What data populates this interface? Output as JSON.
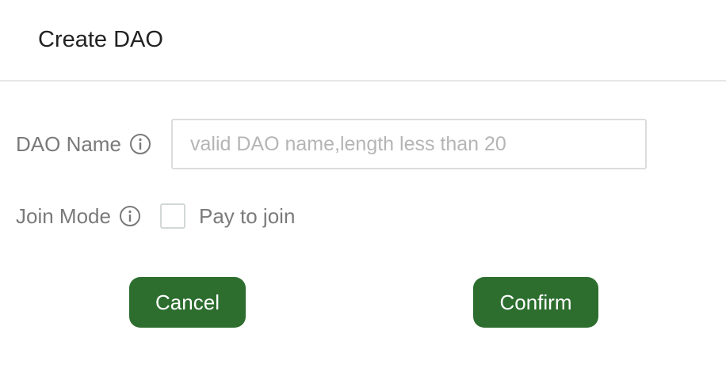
{
  "dialog": {
    "title": "Create DAO"
  },
  "form": {
    "dao_name": {
      "label": "DAO Name",
      "placeholder": "valid DAO name,length less than 20",
      "value": ""
    },
    "join_mode": {
      "label": "Join Mode",
      "option_label": "Pay to join",
      "checked": false
    }
  },
  "actions": {
    "cancel_label": "Cancel",
    "confirm_label": "Confirm"
  },
  "colors": {
    "primary_button": "#2d6e2f",
    "label_text": "#7a7a7a",
    "placeholder_text": "#b5b5b5"
  },
  "icons": [
    "info-icon"
  ]
}
